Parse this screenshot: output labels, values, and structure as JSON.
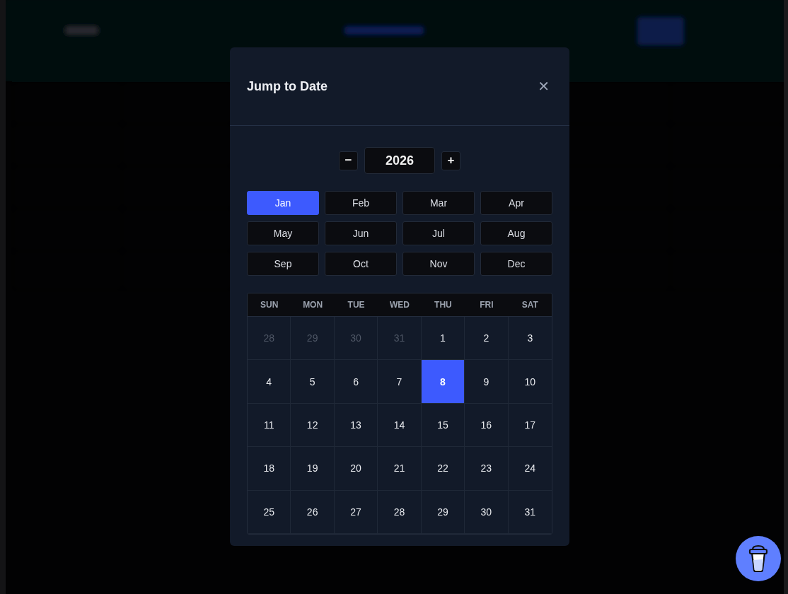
{
  "dialog": {
    "title": "Jump to Date",
    "close": "✕"
  },
  "year": {
    "decrement": "−",
    "value": "2026",
    "increment": "+"
  },
  "months": [
    {
      "label": "Jan",
      "selected": true
    },
    {
      "label": "Feb",
      "selected": false
    },
    {
      "label": "Mar",
      "selected": false
    },
    {
      "label": "Apr",
      "selected": false
    },
    {
      "label": "May",
      "selected": false
    },
    {
      "label": "Jun",
      "selected": false
    },
    {
      "label": "Jul",
      "selected": false
    },
    {
      "label": "Aug",
      "selected": false
    },
    {
      "label": "Sep",
      "selected": false
    },
    {
      "label": "Oct",
      "selected": false
    },
    {
      "label": "Nov",
      "selected": false
    },
    {
      "label": "Dec",
      "selected": false
    }
  ],
  "weekdays": [
    "SUN",
    "MON",
    "TUE",
    "WED",
    "THU",
    "FRI",
    "SAT"
  ],
  "days": [
    {
      "label": "28",
      "outside": true,
      "selected": false
    },
    {
      "label": "29",
      "outside": true,
      "selected": false
    },
    {
      "label": "30",
      "outside": true,
      "selected": false
    },
    {
      "label": "31",
      "outside": true,
      "selected": false
    },
    {
      "label": "1",
      "outside": false,
      "selected": false
    },
    {
      "label": "2",
      "outside": false,
      "selected": false
    },
    {
      "label": "3",
      "outside": false,
      "selected": false
    },
    {
      "label": "4",
      "outside": false,
      "selected": false
    },
    {
      "label": "5",
      "outside": false,
      "selected": false
    },
    {
      "label": "6",
      "outside": false,
      "selected": false
    },
    {
      "label": "7",
      "outside": false,
      "selected": false
    },
    {
      "label": "8",
      "outside": false,
      "selected": true
    },
    {
      "label": "9",
      "outside": false,
      "selected": false
    },
    {
      "label": "10",
      "outside": false,
      "selected": false
    },
    {
      "label": "11",
      "outside": false,
      "selected": false
    },
    {
      "label": "12",
      "outside": false,
      "selected": false
    },
    {
      "label": "13",
      "outside": false,
      "selected": false
    },
    {
      "label": "14",
      "outside": false,
      "selected": false
    },
    {
      "label": "15",
      "outside": false,
      "selected": false
    },
    {
      "label": "16",
      "outside": false,
      "selected": false
    },
    {
      "label": "17",
      "outside": false,
      "selected": false
    },
    {
      "label": "18",
      "outside": false,
      "selected": false
    },
    {
      "label": "19",
      "outside": false,
      "selected": false
    },
    {
      "label": "20",
      "outside": false,
      "selected": false
    },
    {
      "label": "21",
      "outside": false,
      "selected": false
    },
    {
      "label": "22",
      "outside": false,
      "selected": false
    },
    {
      "label": "23",
      "outside": false,
      "selected": false
    },
    {
      "label": "24",
      "outside": false,
      "selected": false
    },
    {
      "label": "25",
      "outside": false,
      "selected": false
    },
    {
      "label": "26",
      "outside": false,
      "selected": false
    },
    {
      "label": "27",
      "outside": false,
      "selected": false
    },
    {
      "label": "28",
      "outside": false,
      "selected": false
    },
    {
      "label": "29",
      "outside": false,
      "selected": false
    },
    {
      "label": "30",
      "outside": false,
      "selected": false
    },
    {
      "label": "31",
      "outside": false,
      "selected": false
    }
  ]
}
